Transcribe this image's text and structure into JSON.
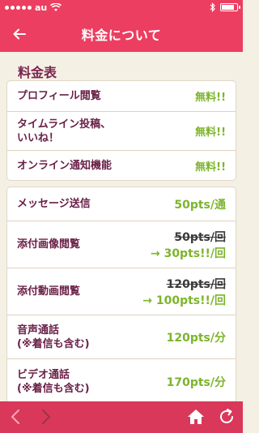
{
  "status_bar": {
    "carrier": "au",
    "battery_level": 0.85
  },
  "header": {
    "title": "料金について"
  },
  "pricing": {
    "section_title": "料金表",
    "free_items": [
      {
        "label": "プロフィール閲覧",
        "price": "無料!!"
      },
      {
        "label": "タイムライン投稿、\nいいね！",
        "price": "無料!!"
      },
      {
        "label": "オンライン通知機能",
        "price": "無料!!"
      }
    ],
    "message": {
      "label": "メッセージ送信",
      "price": "50pts/通"
    },
    "image_view": {
      "label": "添付画像閲覧",
      "old_price": "50pts/回",
      "new_price": "→ 30pts!!/回"
    },
    "video_view": {
      "label": "添付動画閲覧",
      "old_price": "120pts/回",
      "new_price": "→ 100pts!!/回"
    },
    "voice_call": {
      "label": "音声通話\n(※着信も含む)",
      "price": "120pts/分"
    },
    "video_call": {
      "label": "ビデオ通話\n(※着信も含む)",
      "price": "170pts/分"
    }
  },
  "colors": {
    "accent": "#ec3e60",
    "label": "#6a2048",
    "price": "#7db42c",
    "background": "#f5f0e4"
  },
  "icons": {
    "back": "arrow-left-icon",
    "nav_back": "chevron-left-icon",
    "nav_forward": "chevron-right-icon",
    "home": "home-icon",
    "reload": "reload-icon"
  }
}
